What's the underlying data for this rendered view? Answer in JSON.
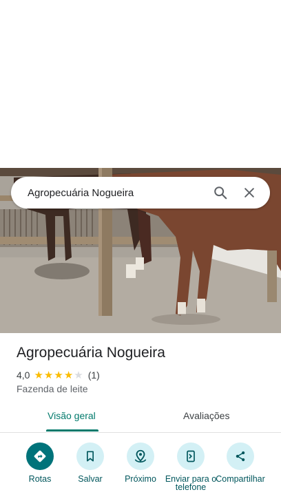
{
  "search": {
    "query": "Agropecuária Nogueira"
  },
  "place": {
    "name": "Agropecuária Nogueira",
    "rating": "4,0",
    "rating_value": 4.0,
    "stars_max": 5,
    "review_count": "(1)",
    "category": "Fazenda de leite"
  },
  "tabs": [
    {
      "label": "Visão geral",
      "selected": true
    },
    {
      "label": "Avaliações",
      "selected": false
    }
  ],
  "actions": [
    {
      "label": "Rotas",
      "icon": "directions-icon"
    },
    {
      "label": "Salvar",
      "icon": "bookmark-icon"
    },
    {
      "label": "Próximo",
      "icon": "nearby-icon"
    },
    {
      "label": "Enviar para o telefone",
      "icon": "send-to-phone-icon"
    },
    {
      "label": "Compartilhar",
      "icon": "share-icon"
    }
  ],
  "colors": {
    "accent": "#00796b",
    "star": "#fbbc04",
    "star_empty": "#dadce0",
    "action_bg": "#d3f0f5",
    "action_primary_bg": "#00737a"
  }
}
